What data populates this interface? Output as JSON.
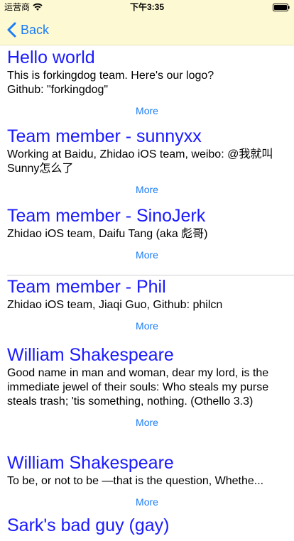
{
  "status_bar": {
    "carrier": "运营商",
    "time": "下午3:35"
  },
  "nav": {
    "back_label": "Back"
  },
  "feed": [
    {
      "title": "Hello world",
      "body": "This is forkingdog team. Here's our logo?\nGithub: \"forkingdog\"",
      "more_label": "More"
    },
    {
      "title": "Team member - sunnyxx",
      "body": "Working at Baidu, Zhidao iOS team, weibo: @我就叫Sunny怎么了",
      "more_label": "More"
    },
    {
      "title": "Team member - SinoJerk",
      "body": "Zhidao iOS team, Daifu Tang (aka 彪哥)",
      "more_label": "More"
    },
    {
      "title": "Team member - Phil",
      "body": "Zhidao iOS team, Jiaqi Guo, Github: philcn",
      "more_label": "More"
    },
    {
      "title": "William Shakespeare",
      "body": "Good name in man and woman, dear my lord, is the immediate jewel of their souls: Who steals my purse steals trash; 'tis something, nothing. (Othello 3.3)",
      "more_label": "More"
    },
    {
      "title": "William Shakespeare",
      "body": "To be, or not to be —that is the question, Whethe...",
      "more_label": "More"
    },
    {
      "title": "Sark's bad guy (gay)"
    }
  ],
  "colors": {
    "navbar_bg": "#fdf9d3",
    "title": "#1a1aff",
    "accent": "#1b7cf6"
  }
}
